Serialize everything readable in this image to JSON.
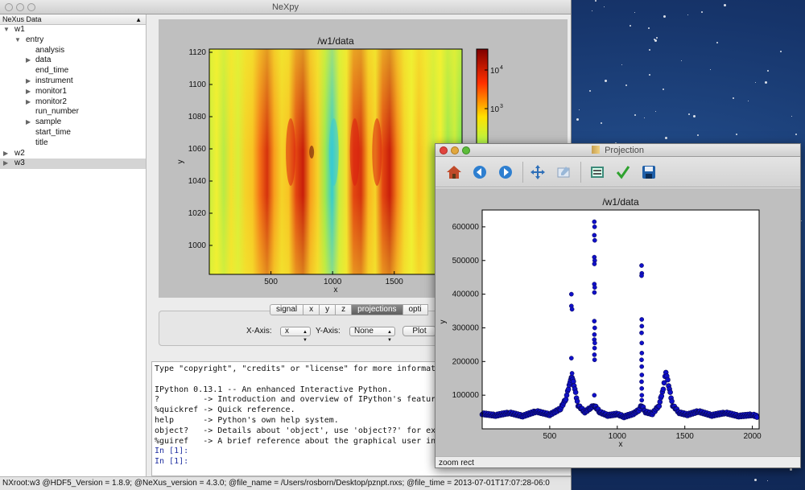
{
  "main_window": {
    "title": "NeXpy",
    "tree": {
      "header": "NeXus Data",
      "items": [
        {
          "label": "w1",
          "icon": "expanded"
        },
        {
          "label": "entry",
          "icon": "expanded"
        },
        {
          "label": "analysis",
          "icon": "none"
        },
        {
          "label": "data",
          "icon": "collapsed"
        },
        {
          "label": "end_time",
          "icon": "none"
        },
        {
          "label": "instrument",
          "icon": "collapsed"
        },
        {
          "label": "monitor1",
          "icon": "collapsed"
        },
        {
          "label": "monitor2",
          "icon": "collapsed"
        },
        {
          "label": "run_number",
          "icon": "none"
        },
        {
          "label": "sample",
          "icon": "collapsed"
        },
        {
          "label": "start_time",
          "icon": "none"
        },
        {
          "label": "title",
          "icon": "none"
        },
        {
          "label": "w2",
          "icon": "collapsed"
        },
        {
          "label": "w3",
          "icon": "collapsed",
          "selected": true
        }
      ]
    },
    "plot": {
      "title": "/w1/data",
      "xlabel": "x",
      "ylabel": "y",
      "xticks": [
        "500",
        "1000",
        "1500"
      ],
      "yticks": [
        "1000",
        "1020",
        "1040",
        "1060",
        "1080",
        "1100",
        "1120"
      ],
      "colorbar_ticks": [
        "10",
        "10"
      ],
      "colorbar_exponents": [
        "4",
        "3"
      ]
    },
    "tabs": [
      "signal",
      "x",
      "y",
      "z",
      "projections",
      "opti"
    ],
    "active_tab": "projections",
    "projection_controls": {
      "x_axis_label": "X-Axis:",
      "x_axis_value": "x",
      "y_axis_label": "Y-Axis:",
      "y_axis_value": "None",
      "plot_button": "Plot"
    },
    "console_lines": [
      {
        "text": "Type \"copyright\", \"credits\" or \"license\" for more information.",
        "prompt": false
      },
      {
        "text": "",
        "prompt": false
      },
      {
        "text": "IPython 0.13.1 -- An enhanced Interactive Python.",
        "prompt": false
      },
      {
        "text": "?         -> Introduction and overview of IPython's features.",
        "prompt": false
      },
      {
        "text": "%quickref -> Quick reference.",
        "prompt": false
      },
      {
        "text": "help      -> Python's own help system.",
        "prompt": false
      },
      {
        "text": "object?   -> Details about 'object', use 'object??' for extra d",
        "prompt": false
      },
      {
        "text": "%guiref   -> A brief reference about the graphical user interfa",
        "prompt": false
      },
      {
        "text": "In [1]:",
        "prompt": true
      },
      {
        "text": "In [1]:",
        "prompt": true
      }
    ],
    "status": "NXroot:w3 @HDF5_Version = 1.8.9; @NeXus_version = 4.3.0; @file_name = /Users/rosborn/Desktop/pznpt.nxs; @file_time = 2013-07-01T17:07:28-06:0"
  },
  "projection_window": {
    "title": "Projection",
    "toolbar": [
      "home-icon",
      "back-icon",
      "forward-icon",
      "pan-icon",
      "zoom-icon",
      "configure-subplots-icon",
      "edit-icon",
      "save-icon"
    ],
    "status": "zoom rect"
  },
  "colors": {
    "scatter": "#1010c8",
    "heatmap_base": "#f0f032",
    "active_tab": "#6e6e6e"
  },
  "chart_data": [
    {
      "type": "heatmap",
      "title": "/w1/data",
      "xlabel": "x",
      "ylabel": "y",
      "xlim": [
        0,
        2050
      ],
      "ylim": [
        982,
        1122
      ],
      "xticks": [
        500,
        1000,
        1500
      ],
      "yticks": [
        1000,
        1020,
        1040,
        1060,
        1080,
        1100,
        1120
      ],
      "colorbar": {
        "scale": "log",
        "ticks": [
          "10^4",
          "10^3"
        ],
        "colormap": "jet"
      },
      "features": [
        {
          "x": 660,
          "level": "high"
        },
        {
          "x": 830,
          "level": "very high"
        },
        {
          "x": 1010,
          "level": "low"
        },
        {
          "x": 1180,
          "level": "high"
        },
        {
          "x": 1360,
          "level": "high"
        }
      ]
    },
    {
      "type": "scatter",
      "title": "/w1/data",
      "xlabel": "x",
      "ylabel": "y",
      "xlim": [
        0,
        2050
      ],
      "ylim": [
        0,
        650000
      ],
      "xticks": [
        500,
        1000,
        1500,
        2000
      ],
      "yticks": [
        100000,
        200000,
        300000,
        400000,
        500000,
        600000
      ],
      "baseline": [
        [
          0,
          45000
        ],
        [
          100,
          40000
        ],
        [
          200,
          48000
        ],
        [
          300,
          38000
        ],
        [
          400,
          52000
        ],
        [
          500,
          42000
        ],
        [
          580,
          60000
        ],
        [
          620,
          90000
        ],
        [
          650,
          140000
        ],
        [
          665,
          155000
        ],
        [
          680,
          130000
        ],
        [
          710,
          70000
        ],
        [
          760,
          50000
        ],
        [
          800,
          62000
        ],
        [
          830,
          70000
        ],
        [
          870,
          50000
        ],
        [
          930,
          40000
        ],
        [
          1000,
          44000
        ],
        [
          1050,
          36000
        ],
        [
          1120,
          45000
        ],
        [
          1160,
          56000
        ],
        [
          1180,
          70000
        ],
        [
          1210,
          50000
        ],
        [
          1260,
          45000
        ],
        [
          1310,
          70000
        ],
        [
          1340,
          120000
        ],
        [
          1360,
          170000
        ],
        [
          1380,
          130000
        ],
        [
          1410,
          70000
        ],
        [
          1460,
          48000
        ],
        [
          1520,
          42000
        ],
        [
          1600,
          52000
        ],
        [
          1700,
          40000
        ],
        [
          1800,
          48000
        ],
        [
          1900,
          38000
        ],
        [
          2000,
          42000
        ],
        [
          2040,
          36000
        ]
      ],
      "outliers": [
        [
          660,
          400000
        ],
        [
          660,
          365000
        ],
        [
          665,
          355000
        ],
        [
          660,
          210000
        ],
        [
          665,
          165000
        ],
        [
          830,
          615000
        ],
        [
          832,
          600000
        ],
        [
          830,
          575000
        ],
        [
          833,
          560000
        ],
        [
          830,
          510000
        ],
        [
          833,
          500000
        ],
        [
          831,
          490000
        ],
        [
          830,
          430000
        ],
        [
          833,
          420000
        ],
        [
          831,
          405000
        ],
        [
          830,
          320000
        ],
        [
          833,
          300000
        ],
        [
          831,
          280000
        ],
        [
          830,
          265000
        ],
        [
          834,
          255000
        ],
        [
          832,
          240000
        ],
        [
          831,
          220000
        ],
        [
          832,
          205000
        ],
        [
          830,
          100000
        ],
        [
          1180,
          485000
        ],
        [
          1182,
          462000
        ],
        [
          1180,
          455000
        ],
        [
          1181,
          325000
        ],
        [
          1182,
          305000
        ],
        [
          1180,
          285000
        ],
        [
          1181,
          255000
        ],
        [
          1182,
          225000
        ],
        [
          1180,
          205000
        ],
        [
          1181,
          185000
        ],
        [
          1182,
          160000
        ],
        [
          1180,
          140000
        ],
        [
          1181,
          120000
        ],
        [
          1182,
          100000
        ],
        [
          1181,
          85000
        ]
      ]
    }
  ]
}
